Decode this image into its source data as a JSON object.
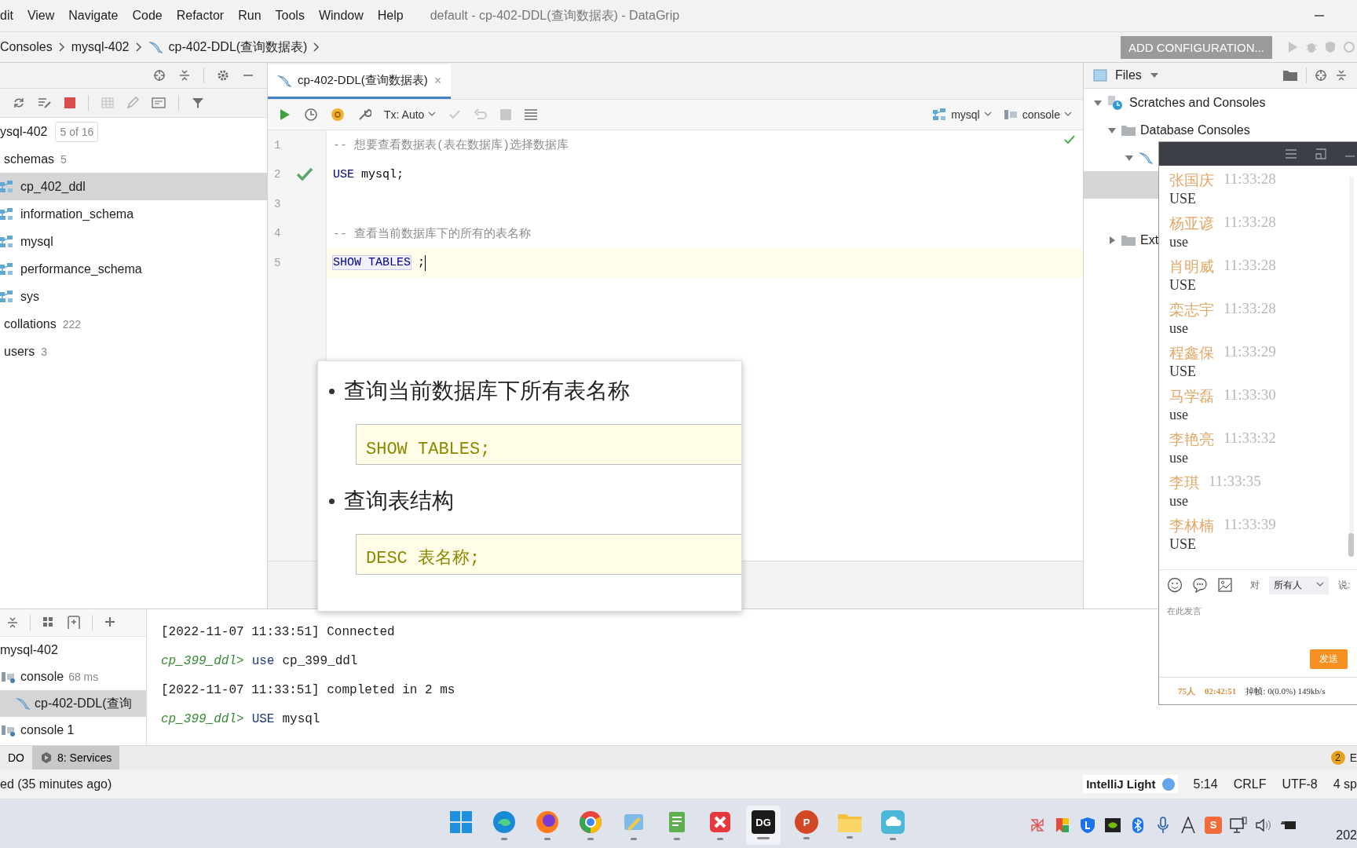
{
  "window": {
    "menu": [
      {
        "label": "dit"
      },
      {
        "label": "View"
      },
      {
        "label": "Navigate"
      },
      {
        "label": "Code"
      },
      {
        "label": "Refactor"
      },
      {
        "label": "Run"
      },
      {
        "label": "Tools"
      },
      {
        "label": "Window"
      },
      {
        "label": "Help"
      }
    ],
    "title": "default - cp-402-DDL(查询数据表) - DataGrip"
  },
  "navbar": {
    "breadcrumbs": [
      "Consoles",
      "mysql-402",
      "cp-402-DDL(查询数据表)"
    ],
    "run_config": "ADD CONFIGURATION..."
  },
  "database_panel": {
    "root": {
      "label": "ysql-402",
      "badge": "5 of 16"
    },
    "items": [
      {
        "label": "schemas",
        "count": "5",
        "selected": false,
        "children": [
          {
            "label": "cp_402_ddl",
            "kind": "schema",
            "selected": true
          },
          {
            "label": "information_schema",
            "kind": "schema",
            "selected": false
          },
          {
            "label": "mysql",
            "kind": "schema",
            "selected": false
          },
          {
            "label": "performance_schema",
            "kind": "schema",
            "selected": false
          },
          {
            "label": "sys",
            "kind": "schema",
            "selected": false
          }
        ]
      },
      {
        "label": "collations",
        "count": "222",
        "selected": false
      },
      {
        "label": "users",
        "count": "3",
        "selected": false
      }
    ]
  },
  "editor": {
    "tab": {
      "label": "cp-402-DDL(查询数据表)",
      "close": "×"
    },
    "toolbar": {
      "transaction": "Tx: Auto",
      "datasource": "mysql",
      "session": "console"
    },
    "lines": [
      {
        "number": "1",
        "current": false,
        "executed": false,
        "tokens": [
          {
            "text": "-- 想要查看数据表(表在数据库)选择数据库",
            "kind": "comment"
          }
        ]
      },
      {
        "number": "2",
        "current": false,
        "executed": true,
        "tokens": [
          {
            "text": "USE",
            "kind": "keyword"
          },
          {
            "text": " mysql;",
            "kind": "plain"
          }
        ]
      },
      {
        "number": "3",
        "current": false,
        "executed": false
      },
      {
        "number": "4",
        "current": false,
        "executed": false,
        "tokens": [
          {
            "text": "-- 查看当前数据库下的所有的表名称",
            "kind": "comment"
          }
        ]
      },
      {
        "number": "5",
        "current": true,
        "executed": false,
        "tokens": [
          {
            "text": "SHOW TABLES",
            "kind": "match"
          },
          {
            "text": " ;",
            "kind": "plain"
          }
        ]
      }
    ]
  },
  "files_panel": {
    "title": "Files",
    "tree": [
      {
        "label": "Scratches and Consoles",
        "kind": "scratches",
        "expanded": true,
        "children": [
          {
            "label": "Database Consoles",
            "kind": "folder",
            "expanded": true,
            "children": [
              {
                "kind": "dolphin",
                "expanded": true,
                "children": [
                  {
                    "selected": true
                  },
                  {
                    "selected": false
                  }
                ]
              }
            ]
          },
          {
            "label": "Ext",
            "kind": "folder",
            "expanded": false
          }
        ]
      }
    ]
  },
  "chat": {
    "messages": [
      {
        "name": "张国庆",
        "time": "11:33:28",
        "text": "USE"
      },
      {
        "name": "杨亚谚",
        "time": "11:33:28",
        "text": "use"
      },
      {
        "name": "肖明威",
        "time": "11:33:28",
        "text": "USE"
      },
      {
        "name": "栾志宇",
        "time": "11:33:28",
        "text": "use"
      },
      {
        "name": "程鑫保",
        "time": "11:33:29",
        "text": "USE"
      },
      {
        "name": "马学磊",
        "time": "11:33:30",
        "text": "use"
      },
      {
        "name": "李艳亮",
        "time": "11:33:32",
        "text": "use"
      },
      {
        "name": "李琪",
        "time": "11:33:35",
        "text": "use"
      },
      {
        "name": "李林楠",
        "time": "11:33:39",
        "text": "USE"
      }
    ],
    "recipient_label": "对",
    "recipient": "所有人",
    "say_label": "说:",
    "input": {
      "placeholder": "在此发言"
    },
    "send": "发送",
    "footer": {
      "count": "75人",
      "duration": "02:42:51",
      "stats": "掉帧: 0(0.0%) 149kb/s"
    }
  },
  "slide": {
    "items": [
      {
        "heading": "查询当前数据库下所有表名称",
        "code": "SHOW TABLES;"
      },
      {
        "heading": "查询表结构",
        "code": "DESC 表名称;"
      }
    ]
  },
  "services": {
    "tree": [
      {
        "label": "mysql-402",
        "selected": false,
        "children": [
          {
            "label": "console",
            "detail": "68 ms",
            "kind": "session",
            "selected": false,
            "children": [
              {
                "label": "cp-402-DDL(查询",
                "kind": "file",
                "selected": true
              }
            ]
          },
          {
            "label": "console 1",
            "kind": "session",
            "selected": false
          }
        ]
      }
    ],
    "output": [
      {
        "kind": "info",
        "text": "[2022-11-07 11:33:51] Connected"
      },
      {
        "kind": "command",
        "prompt": "cp_399_ddl>",
        "keyword": "use",
        "rest": "cp_399_ddl"
      },
      {
        "kind": "info",
        "text": "[2022-11-07 11:33:51] completed in 2 ms"
      },
      {
        "kind": "command",
        "prompt": "cp_399_ddl>",
        "keyword": "USE",
        "rest": "mysql"
      }
    ]
  },
  "tool_tabs": [
    {
      "label": "DO",
      "selected": false
    },
    {
      "label": "8: Services",
      "selected": true
    }
  ],
  "notifications": {
    "count": "2",
    "label": "E"
  },
  "status_bar": {
    "message": "ed (35 minutes ago)",
    "theme": "IntelliJ Light",
    "position": "5:14",
    "line_separator": "CRLF",
    "encoding": "UTF-8",
    "indent": "4 sp"
  },
  "taskbar": {
    "apps": [
      {
        "kind": "grid",
        "running": false,
        "selected": false
      },
      {
        "kind": "wave",
        "running": true,
        "selected": false
      },
      {
        "kind": "fox",
        "running": true,
        "selected": false
      },
      {
        "kind": "ring",
        "running": true,
        "selected": false
      },
      {
        "kind": "brush",
        "running": true,
        "selected": false
      },
      {
        "kind": "doc",
        "running": true,
        "selected": false
      },
      {
        "kind": "cross",
        "running": true,
        "selected": false
      },
      {
        "kind": "dark",
        "glyph": "DG",
        "running": true,
        "selected": true
      },
      {
        "kind": "slide",
        "glyph": "P",
        "running": true,
        "selected": false
      },
      {
        "kind": "folder",
        "running": true,
        "selected": false
      },
      {
        "kind": "cloud",
        "running": true,
        "selected": false
      }
    ],
    "tray": [
      {
        "kind": "pinwheel"
      },
      {
        "kind": "bookmark"
      },
      {
        "kind": "shield"
      },
      {
        "kind": "chip"
      },
      {
        "kind": "bluetooth"
      },
      {
        "kind": "mic"
      },
      {
        "kind": "letter"
      },
      {
        "kind": "badge",
        "glyph": "S"
      },
      {
        "kind": "monitor"
      },
      {
        "kind": "speaker"
      },
      {
        "kind": "battery"
      }
    ],
    "clock": "202"
  }
}
